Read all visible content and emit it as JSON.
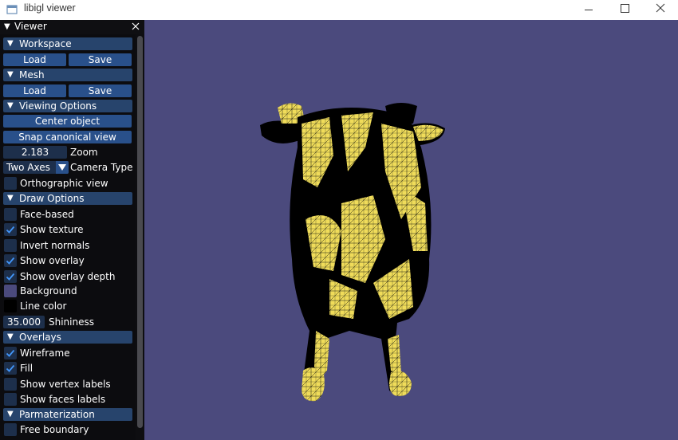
{
  "window": {
    "title": "libigl viewer"
  },
  "colors": {
    "viewport_bg": "#4b4a7d",
    "mesh_fill": "#f0dc5a",
    "mesh_line": "#000000",
    "background_swatch": "#4b4a7d",
    "line_swatch": "#000000"
  },
  "panel": {
    "title": "Viewer",
    "workspace": {
      "header": "Workspace",
      "load": "Load",
      "save": "Save"
    },
    "mesh": {
      "header": "Mesh",
      "load": "Load",
      "save": "Save"
    },
    "viewing": {
      "header": "Viewing Options",
      "center": "Center object",
      "snap": "Snap canonical view",
      "zoom_value": "2.183",
      "zoom_label": "Zoom",
      "camera_value": "Two Axes",
      "camera_label": "Camera Type",
      "ortho": "Orthographic view",
      "ortho_checked": false
    },
    "draw": {
      "header": "Draw Options",
      "items": [
        {
          "label": "Face-based",
          "checked": false
        },
        {
          "label": "Show texture",
          "checked": true
        },
        {
          "label": "Invert normals",
          "checked": false
        },
        {
          "label": "Show overlay",
          "checked": true
        },
        {
          "label": "Show overlay depth",
          "checked": true
        }
      ],
      "background": "Background",
      "line_color": "Line color",
      "shininess_value": "35.000",
      "shininess_label": "Shininess"
    },
    "overlays": {
      "header": "Overlays",
      "items": [
        {
          "label": "Wireframe",
          "checked": true
        },
        {
          "label": "Fill",
          "checked": true
        },
        {
          "label": "Show vertex labels",
          "checked": false
        },
        {
          "label": "Show faces labels",
          "checked": false
        }
      ]
    },
    "param": {
      "header": "Parmaterization",
      "items": [
        {
          "label": "Free boundary",
          "checked": false
        }
      ]
    }
  }
}
